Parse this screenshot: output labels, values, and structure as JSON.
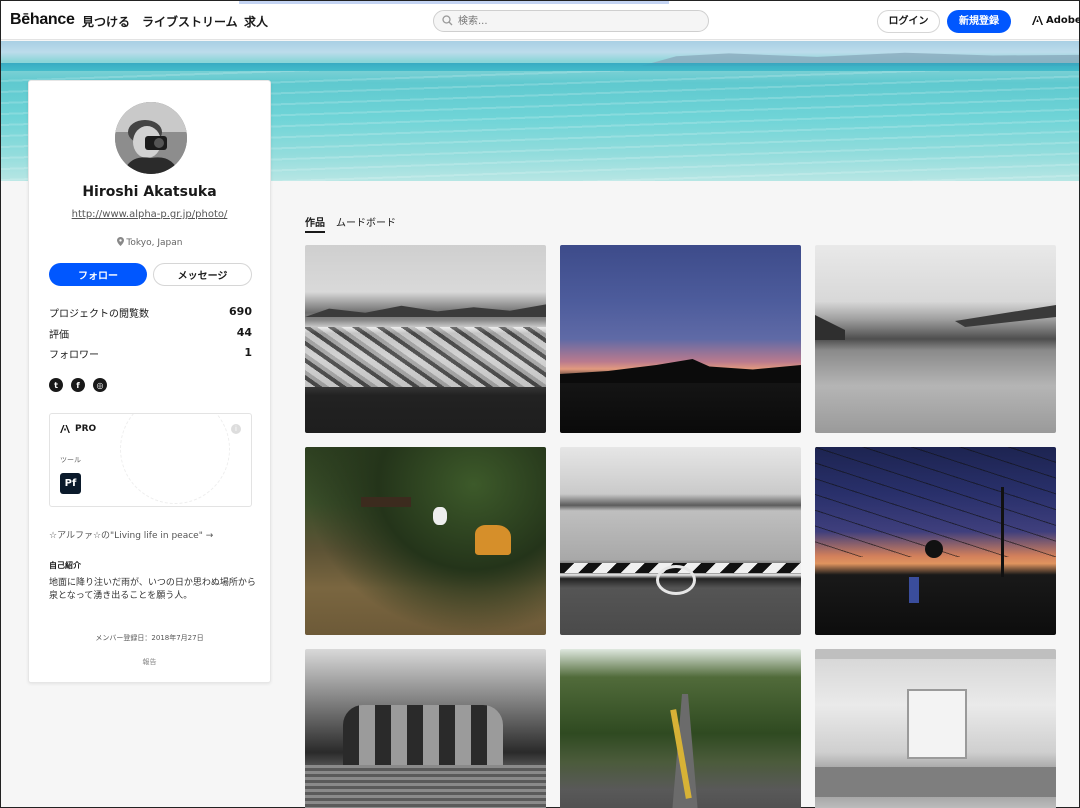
{
  "header": {
    "logo": "Bēhance",
    "nav": [
      "見つける",
      "ライブストリーム",
      "求人"
    ],
    "search_placeholder": "検索...",
    "login": "ログイン",
    "signup": "新規登録",
    "adobe": "Adobe"
  },
  "profile": {
    "name": "Hiroshi Akatsuka",
    "url": "http://www.alpha-p.gr.jp/photo/",
    "location": "Tokyo, Japan",
    "follow": "フォロー",
    "message": "メッセージ",
    "stats": [
      {
        "label": "プロジェクトの閲覧数",
        "value": "690"
      },
      {
        "label": "評価",
        "value": "44"
      },
      {
        "label": "フォロワー",
        "value": "1"
      }
    ],
    "pro": {
      "label": "PRO",
      "tools_label": "ツール",
      "tool": "Pf"
    },
    "tagline": "☆アルファ☆の\"Living life in peace\" →",
    "intro_heading": "自己紹介",
    "intro": "地面に降り注いだ雨が、いつの日か思わぬ場所から泉となって湧き出ることを願う人。",
    "member_since": "メンバー登録日：2018年7月27日",
    "report": "報告"
  },
  "tabs": [
    "作品",
    "ムードボード"
  ],
  "projects": [
    {
      "icon": "photo-monochrome-mural"
    },
    {
      "icon": "photo-dusk-silhouette"
    },
    {
      "icon": "photo-monochrome-pier"
    },
    {
      "icon": "photo-park-playground"
    },
    {
      "icon": "photo-monochrome-seaside"
    },
    {
      "icon": "photo-dusk-powerlines"
    },
    {
      "icon": "photo-monochrome-building"
    },
    {
      "icon": "photo-green-alley"
    },
    {
      "icon": "photo-monochrome-train"
    }
  ],
  "colors": {
    "accent": "#0057ff"
  }
}
